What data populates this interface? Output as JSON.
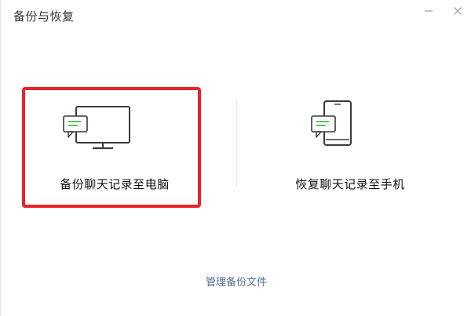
{
  "window": {
    "title": "备份与恢复"
  },
  "options": {
    "backup_to_pc": "备份聊天记录至电脑",
    "restore_to_phone": "恢复聊天记录至手机"
  },
  "footer": {
    "manage_link": "管理备份文件"
  },
  "colors": {
    "highlight": "#e8232b",
    "link": "#576b95",
    "chat_bubble": "#5fbf5f"
  },
  "icons": {
    "minimize": "minimize-icon",
    "close": "close-icon",
    "pc": "computer-chat-icon",
    "phone": "phone-chat-icon"
  }
}
